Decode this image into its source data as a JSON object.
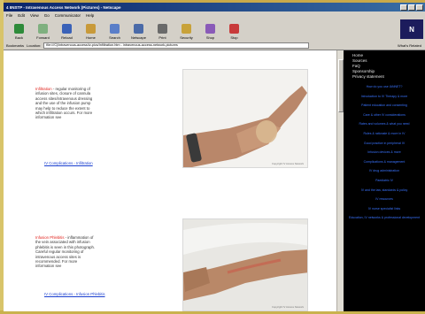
{
  "window": {
    "title": "4 IINSTP - Intravenous Access Network (Pictures) - Netscape",
    "accent": "#0a246a"
  },
  "menu": [
    "File",
    "Edit",
    "View",
    "Go",
    "Communicator",
    "Help"
  ],
  "toolbar": {
    "buttons": [
      {
        "label": "Back",
        "icon": "back-arrow-icon",
        "color": "#2e8b3a"
      },
      {
        "label": "Forward",
        "icon": "forward-arrow-icon",
        "color": "#7fb07f"
      },
      {
        "label": "Reload",
        "icon": "reload-icon",
        "color": "#3a62b8"
      },
      {
        "label": "Home",
        "icon": "home-icon",
        "color": "#c89a3a"
      },
      {
        "label": "Search",
        "icon": "search-icon",
        "color": "#5a7ec8"
      },
      {
        "label": "Netscape",
        "icon": "netscape-icon",
        "color": "#4a6aa8"
      },
      {
        "label": "Print",
        "icon": "print-icon",
        "color": "#6a6a6a"
      },
      {
        "label": "Security",
        "icon": "lock-icon",
        "color": "#c8a23a"
      },
      {
        "label": "Shop",
        "icon": "shop-icon",
        "color": "#8a5ab8"
      },
      {
        "label": "Stop",
        "icon": "stop-icon",
        "color": "#c83a3a"
      }
    ],
    "throbber": "N"
  },
  "location": {
    "bookmarks_label": "Bookmarks",
    "location_label": "Location:",
    "url": "file:///C|/intravenous-access/iv-pics/Infiltration.htm - intravenous-access-network-pictures",
    "related_label": "What's Related"
  },
  "entries": [
    {
      "term": "Infiltration",
      "text": " - regular monitoring of infusion sites, closure of cannula access sites/intravenous dressing and the use of the infusion pump may help to reduce the extent to which infiltration occurs. For more information see",
      "link": "IV Complications - Infiltration",
      "caption": "Copyright IV Access Network"
    },
    {
      "term": "Infusion Phlebitis",
      "text": " - inflammation of the vein associated with infusion phlebitis is seen in this photograph. Careful regular monitoring of intravenous access sites is recommended. For more information see",
      "link": "IV Complications - Infusion Phlebitis",
      "caption": "Copyright IV Access Network"
    }
  ],
  "sidebar": {
    "top_links": [
      "Home",
      "Sources",
      "FaQ",
      "Sponsorship",
      "Privacy statement"
    ],
    "links": [
      "How do you use IANNET?",
      "Introduction to IV Therapy & more",
      "Patient education and consenting",
      "Care & other IV considerations",
      "Rates and volumes & what you need",
      "Rules & rationale & more in IV",
      "Good practice in peripheral IV",
      "Infusion devices & more",
      "Complications & management",
      "IV drug administration",
      "Paediatric IV",
      "IV and the law, standards & policy",
      "IV resources",
      "IV nurse specialist links",
      "Education, IV networks & professional development"
    ]
  }
}
